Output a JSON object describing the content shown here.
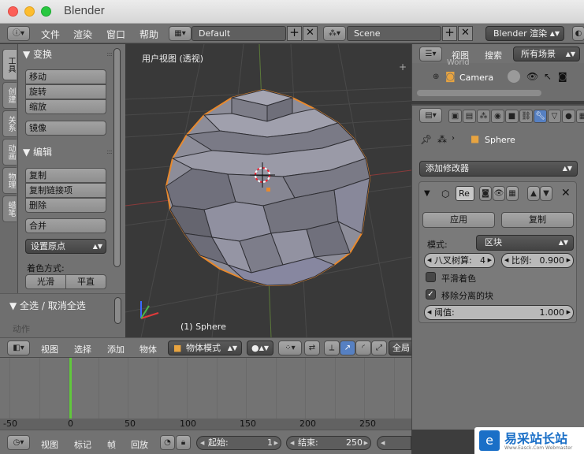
{
  "window": {
    "title": "Blender"
  },
  "top_menu": {
    "items": [
      "文件",
      "渲染",
      "窗口",
      "帮助"
    ],
    "layout": "Default",
    "scene": "Scene",
    "engine": "Blender 渲染"
  },
  "tool_tabs": [
    "工具",
    "创建",
    "关系",
    "动画",
    "物理",
    "蜡笔"
  ],
  "toolshelf": {
    "transform": {
      "title": "▼ 变换",
      "buttons": [
        "移动",
        "旋转",
        "缩放",
        "镜像"
      ]
    },
    "edit": {
      "title": "▼ 编辑",
      "buttons": [
        "复制",
        "复制链接项",
        "删除",
        "合并"
      ],
      "origin": "设置原点",
      "shading_label": "着色方式:",
      "smooth": "光滑",
      "flat": "平直"
    },
    "select_all": "▼ 全选 / 取消全选",
    "action_label": "动作"
  },
  "viewport": {
    "view_label": "用户视图 (透视)",
    "object_label": "(1) Sphere"
  },
  "viewport_header": {
    "menus": [
      "视图",
      "选择",
      "添加",
      "物体"
    ],
    "mode": "物体模式",
    "global": "全局"
  },
  "timeline": {
    "ticks": [
      "-50",
      "0",
      "50",
      "100",
      "150",
      "200",
      "250"
    ],
    "current_frame": 1
  },
  "timeline_header": {
    "menus": [
      "视图",
      "标记",
      "帧",
      "回放"
    ],
    "start_label": "起始:",
    "start_value": "1",
    "end_label": "结束:",
    "end_value": "250"
  },
  "outliner": {
    "view_label": "视图",
    "search_label": "搜索",
    "filter": "所有场景",
    "partial_item": "World",
    "item": "Camera"
  },
  "properties": {
    "object_name": "Sphere",
    "add_modifier": "添加修改器",
    "modifier": {
      "name": "Re",
      "apply": "应用",
      "copy": "复制",
      "mode_label": "模式:",
      "mode_value": "区块",
      "octree_label": "八叉树算:",
      "octree_value": "4",
      "scale_label": "比例:",
      "scale_value": "0.900",
      "smooth_label": "平滑着色",
      "smooth_checked": false,
      "remove_label": "移除分离的块",
      "remove_checked": true,
      "threshold_label": "阈值:",
      "threshold_value": "1.000"
    }
  },
  "watermark": {
    "text": "易采站长站",
    "sub": "Www.Easck.Com Webmaster"
  },
  "colors": {
    "accent": "#5680c2",
    "playhead": "#61c83c",
    "selection_outline": "#e8892d"
  }
}
